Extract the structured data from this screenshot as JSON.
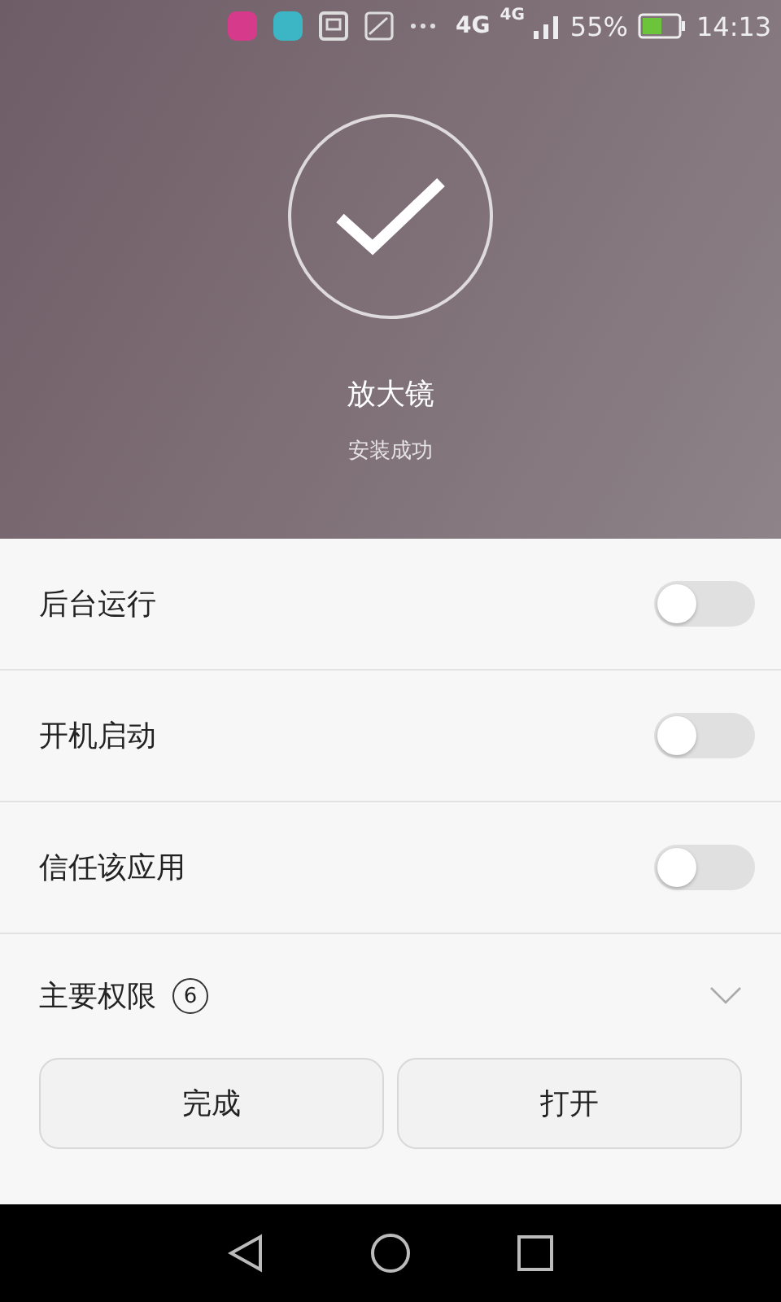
{
  "status_bar": {
    "network_1": "4G",
    "network_2": "4G",
    "battery": "55%",
    "time": "14:13"
  },
  "app": {
    "name": "放大镜",
    "status": "安装成功"
  },
  "settings": [
    {
      "label": "后台运行",
      "on": false
    },
    {
      "label": "开机启动",
      "on": false
    },
    {
      "label": "信任该应用",
      "on": false
    }
  ],
  "permissions": {
    "label": "主要权限",
    "count": "6",
    "expanded": false
  },
  "buttons": [
    "完成",
    "打开"
  ]
}
